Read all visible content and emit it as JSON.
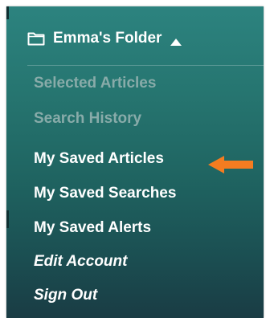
{
  "folder": {
    "title": "Emma's Folder",
    "icon": "folder-icon",
    "toggle_icon": "caret-up-icon"
  },
  "menu": {
    "items": [
      {
        "label": "Selected Articles",
        "state": "disabled"
      },
      {
        "label": "Search History",
        "state": "disabled"
      },
      {
        "label": "My Saved Articles",
        "state": "enabled"
      },
      {
        "label": "My Saved Searches",
        "state": "enabled"
      },
      {
        "label": "My Saved Alerts",
        "state": "enabled"
      },
      {
        "label": "Edit Account",
        "state": "enabled"
      },
      {
        "label": "Sign Out",
        "state": "enabled"
      }
    ]
  },
  "annotation": {
    "icon": "arrow-left-icon",
    "color": "#f47c20"
  },
  "colors": {
    "panel_top": "#2c837f",
    "panel_bottom": "#1a3c44",
    "text": "#ffffff",
    "muted_text": "#88aba9"
  }
}
